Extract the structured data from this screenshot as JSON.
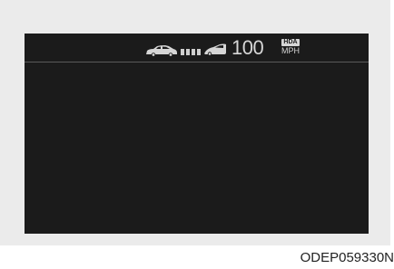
{
  "display": {
    "speed": "100",
    "badge": "HDA",
    "unit": "MPH",
    "gap_level": 4,
    "icons": {
      "own_vehicle": "car-icon",
      "lead_vehicle": "lead-car-icon"
    }
  },
  "caption": "ODEP059330N",
  "colors": {
    "screen_background": "#1b1b1b",
    "frame_background": "#ebebeb",
    "display_text": "#d6d6d6"
  }
}
